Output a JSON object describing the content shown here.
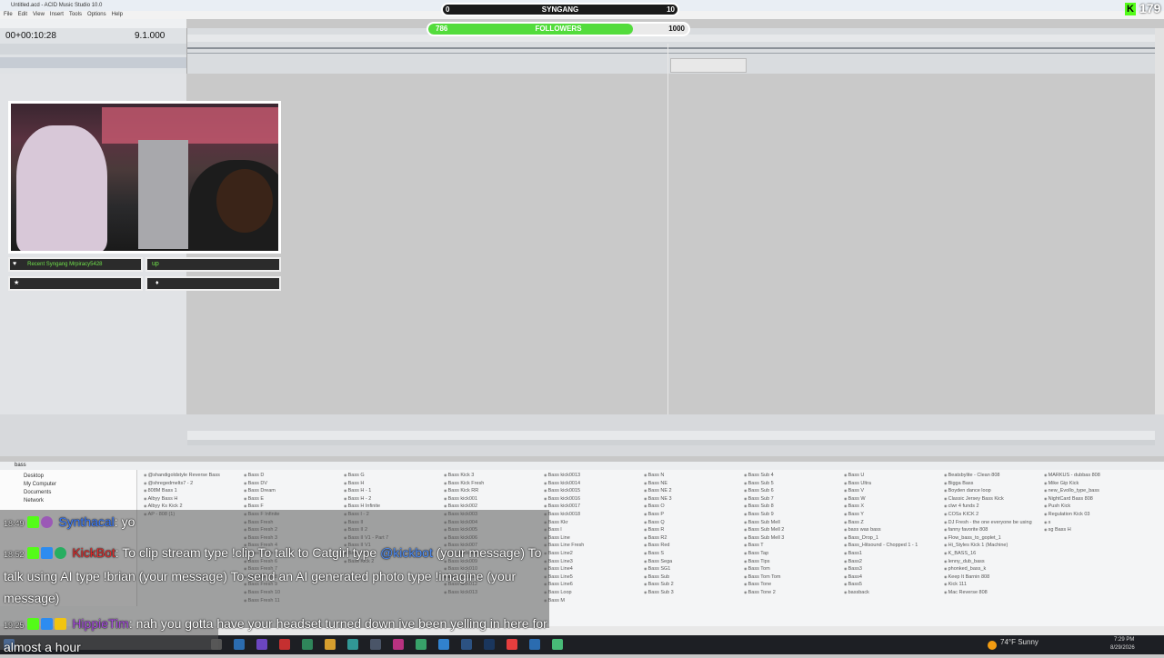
{
  "window": {
    "title": "Untitled.acd - ACID Music Studio 10.0"
  },
  "menu": [
    "File",
    "Edit",
    "View",
    "Insert",
    "Tools",
    "Options",
    "Help"
  ],
  "transport": {
    "timecode": "00+00:10:28",
    "bpm": "9.1.000"
  },
  "explorer": {
    "path": "bass",
    "tree": [
      "Desktop",
      "My Computer",
      "Documents",
      "Network"
    ],
    "columns": [
      [
        "@shandigoldstyle Reverse Bass",
        "@shregedmelts7 - 2",
        "808M Bass 1",
        "Albyy Bass H",
        "Albyy Ks Kick 2",
        "AP - 808 (1)"
      ],
      [
        "Bass D",
        "Bass DV",
        "Bass Dream",
        "Bass E",
        "Bass F",
        "Bass F Infinite",
        "Bass Fresh",
        "Bass Fresh 2",
        "Bass Fresh 3",
        "Bass Fresh 4",
        "Bass Fresh 5",
        "Bass Fresh 6",
        "Bass Fresh 7",
        "Bass Fresh 8",
        "Bass Fresh 9",
        "Bass Fresh 10",
        "Bass Fresh 11"
      ],
      [
        "Bass G",
        "Bass H",
        "Bass H - 1",
        "Bass H - 2",
        "Bass H Infinite",
        "Bass I - 2",
        "Bass II",
        "Bass II 2",
        "Bass II V1 - Part 7",
        "Bass II V1",
        "Bass Kick 1",
        "Bass Kick 2"
      ],
      [
        "Bass Kick 3",
        "Bass Kick Fresh",
        "Bass Kick RR",
        "Bass kick001",
        "Bass kick002",
        "Bass kick003",
        "Bass kick004",
        "Bass kick005",
        "Bass kick006",
        "Bass kick007",
        "Bass kick008",
        "Bass kick009",
        "Bass kick010",
        "Bass kick011",
        "Bass kick012",
        "Bass kick013"
      ],
      [
        "Bass kick0013",
        "Bass kick0014",
        "Bass kick0015",
        "Bass kick0016",
        "Bass kick0017",
        "Bass kick0018",
        "Bass Kkr",
        "Bass l",
        "Bass Line",
        "Bass Line Fresh",
        "Bass Line2",
        "Bass Line3",
        "Bass Line4",
        "Bass Line5",
        "Bass Line6",
        "Bass Loop",
        "Bass M"
      ],
      [
        "Bass N",
        "Bass NE",
        "Bass NE 2",
        "Bass NE 3",
        "Bass O",
        "Bass P",
        "Bass Q",
        "Bass R",
        "Bass R2",
        "Bass Red",
        "Bass S",
        "Bass Sega",
        "Bass SG1",
        "Bass Sub",
        "Bass Sub 2",
        "Bass Sub 3"
      ],
      [
        "Bass Sub 4",
        "Bass Sub 5",
        "Bass Sub 6",
        "Bass Sub 7",
        "Bass Sub 8",
        "Bass Sub 9",
        "Bass Sub Mell",
        "Bass Sub Mell 2",
        "Bass Sub Mell 3",
        "Bass T",
        "Bass Tap",
        "Bass Tips",
        "Bass Tom",
        "Bass Tom Tom",
        "Bass Tone",
        "Bass Tone 2"
      ],
      [
        "Bass U",
        "Bass Ultra",
        "Bass V",
        "Bass W",
        "Bass X",
        "Bass Y",
        "Bass Z",
        "bass was bass",
        "Bass_Drop_1",
        "Bass_Hitsound - Chopped 1 - 1",
        "Bass1",
        "Bass2",
        "Bass3",
        "Bass4",
        "Bass5",
        "bassback"
      ],
      [
        "Beatsbylite - Clean 808",
        "Bigga Bass",
        "Boyden dance loop",
        "Classic Jersey Bass Kick",
        "clwr 4 funds 2",
        "COSs KICK 2",
        "DJ Fresh - the one everyone be using",
        "fanny favorite 808",
        "Flow_bass_to_goplet_1",
        "Hi_Styles Kick 1 (Machine)",
        "K_BASS_16",
        "lenny_dub_bass",
        "phonked_bass_k",
        "Keep It Barnin 808",
        "Kick 111",
        "Mac Reverse 808"
      ],
      [
        "MARKUS - dubbas 808",
        "Mike Gip Kick",
        "new_Evollo_type_bass",
        "NightCard Bass 808",
        "Push Kick",
        "Regulation Kick 03",
        "s",
        "sg Bass H"
      ]
    ]
  },
  "overlays": {
    "goal1": {
      "label": "SYNGANG",
      "current": "0",
      "target": "10"
    },
    "goal2": {
      "label": "FOLLOWERS",
      "current": "786",
      "target": "1000",
      "progress": 0.786
    },
    "viewer_count": "179",
    "recent_label": "Recent Syngang Mrpiracy5428",
    "recent_value": "up",
    "panel_star": "★",
    "panel_drop": "♦"
  },
  "chat": [
    {
      "time": "18:49",
      "user": "Synthacal",
      "user_color": "#3b7cff",
      "text": ": yo"
    },
    {
      "time": "18:52",
      "user": "KickBot",
      "user_color": "#e02b2b",
      "text_pre": ": To clip stream type !clip To talk to Catgirl type ",
      "mention": "@kickbot",
      "text_post": " (your message) To talk using AI type !brian (your message) To send an AI generated photo type !imagine (your message)"
    },
    {
      "time": "19:25",
      "user": "HippieTim",
      "user_color": "#a84de0",
      "text": ": nah you gotta have your headset turned down ive been yelling in here for almost a hour"
    }
  ],
  "taskbar": {
    "weather": "74°F Sunny",
    "time": "7:29 PM",
    "date": "8/29/2026"
  },
  "colors": {
    "kick_green": "#53fc18",
    "goal_green": "#53dc3c"
  }
}
